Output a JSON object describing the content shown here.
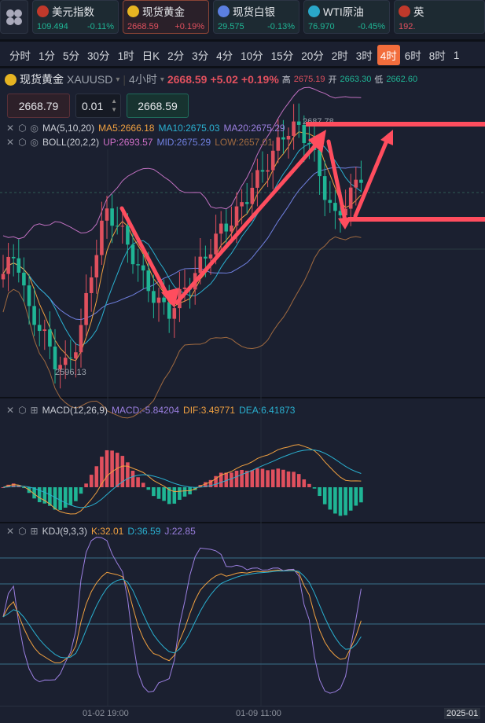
{
  "tickers": [
    {
      "name": "美元指数",
      "price": "109.494",
      "change": "-0.11%",
      "dir": "dn",
      "icon": "us-flag-icon",
      "color": "#c0392b"
    },
    {
      "name": "现货黄金",
      "price": "2668.59",
      "change": "+0.19%",
      "dir": "up",
      "icon": "gold-bar-icon",
      "color": "#e6b422",
      "active": true
    },
    {
      "name": "现货白银",
      "price": "29.575",
      "change": "-0.13%",
      "dir": "dn",
      "icon": "silver-icon",
      "color": "#5b7fe0"
    },
    {
      "name": "WTI原油",
      "price": "76.970",
      "change": "-0.45%",
      "dir": "dn",
      "icon": "oil-icon",
      "color": "#2aa7c9"
    },
    {
      "name": "英",
      "price": "192.",
      "change": "",
      "dir": "up",
      "icon": "uk-flag-icon",
      "color": "#c0392b"
    }
  ],
  "timeframes": [
    "分时",
    "1分",
    "5分",
    "30分",
    "1时",
    "日K",
    "2分",
    "3分",
    "4分",
    "10分",
    "15分",
    "20分",
    "2时",
    "3时",
    "4时",
    "6时",
    "8时",
    "1"
  ],
  "selected_timeframe": "4时",
  "symbol": {
    "name": "现货黄金",
    "code": "XAUUSD",
    "period": "4小时",
    "price": "2668.59",
    "change": "+5.02",
    "pct": "+0.19%",
    "high_label": "高",
    "high": "2675.19",
    "open_label": "开",
    "open": "2663.30",
    "low_label": "低",
    "low": "2662.60"
  },
  "order": {
    "sell": "2668.79",
    "qty": "0.01",
    "buy": "2668.59"
  },
  "indicators": {
    "ma": {
      "name": "MA(5,10,20)",
      "ma5": "MA5:2666.18",
      "ma10": "MA10:2675.03",
      "ma20": "MA20:2675.29"
    },
    "boll": {
      "name": "BOLL(20,2,2)",
      "up": "UP:2693.57",
      "mid": "MID:2675.29",
      "low": "LOW:2657.01"
    },
    "macd": {
      "name": "MACD(12,26,9)",
      "macd": "MACD:-5.84204",
      "dif": "DIF:3.49771",
      "dea": "DEA:6.41873"
    },
    "kdj": {
      "name": "KDJ(9,3,3)",
      "k": "K:32.01",
      "d": "D:36.59",
      "j": "J:22.85"
    }
  },
  "chart_labels": {
    "max": "2687.78",
    "min": "2596.13"
  },
  "xaxis": [
    "01-02 19:00",
    "01-09 11:00",
    "2025-01"
  ],
  "chart_data": {
    "type": "candlestick",
    "keypoints": [
      2632,
      2640,
      2618,
      2612,
      2600,
      2598,
      2610,
      2635,
      2655,
      2650,
      2640,
      2630,
      2622,
      2618,
      2625,
      2632,
      2640,
      2648,
      2652,
      2660,
      2668,
      2675,
      2684,
      2686,
      2680,
      2664,
      2652,
      2660,
      2668
    ],
    "colors": {
      "up": "#e0505e",
      "down": "#1fb595"
    }
  }
}
